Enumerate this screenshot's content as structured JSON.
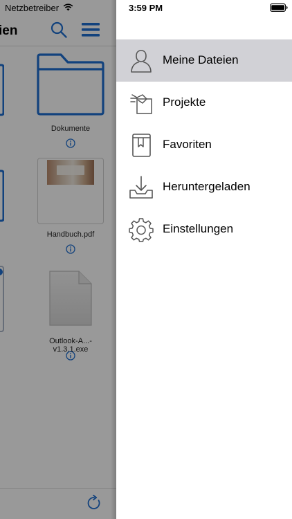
{
  "status_bar": {
    "carrier": "Netzbetreiber",
    "time": "3:59 PM"
  },
  "files_view": {
    "title_fragment": "ien",
    "items": [
      {
        "name": "Dokumente"
      },
      {
        "name": "Handbuch.pdf"
      },
      {
        "name": "Outlook-A...-v1.3.1.exe"
      }
    ]
  },
  "menu": {
    "items": [
      {
        "label": "Meine Dateien",
        "icon": "person-icon",
        "active": true
      },
      {
        "label": "Projekte",
        "icon": "projects-icon",
        "active": false
      },
      {
        "label": "Favoriten",
        "icon": "bookmark-book-icon",
        "active": false
      },
      {
        "label": "Heruntergeladen",
        "icon": "download-tray-icon",
        "active": false
      },
      {
        "label": "Einstellungen",
        "icon": "gear-icon",
        "active": false
      }
    ]
  },
  "colors": {
    "accent": "#1f6fd1",
    "active_row": "#d1d1d6",
    "icon_gray": "#555555"
  }
}
